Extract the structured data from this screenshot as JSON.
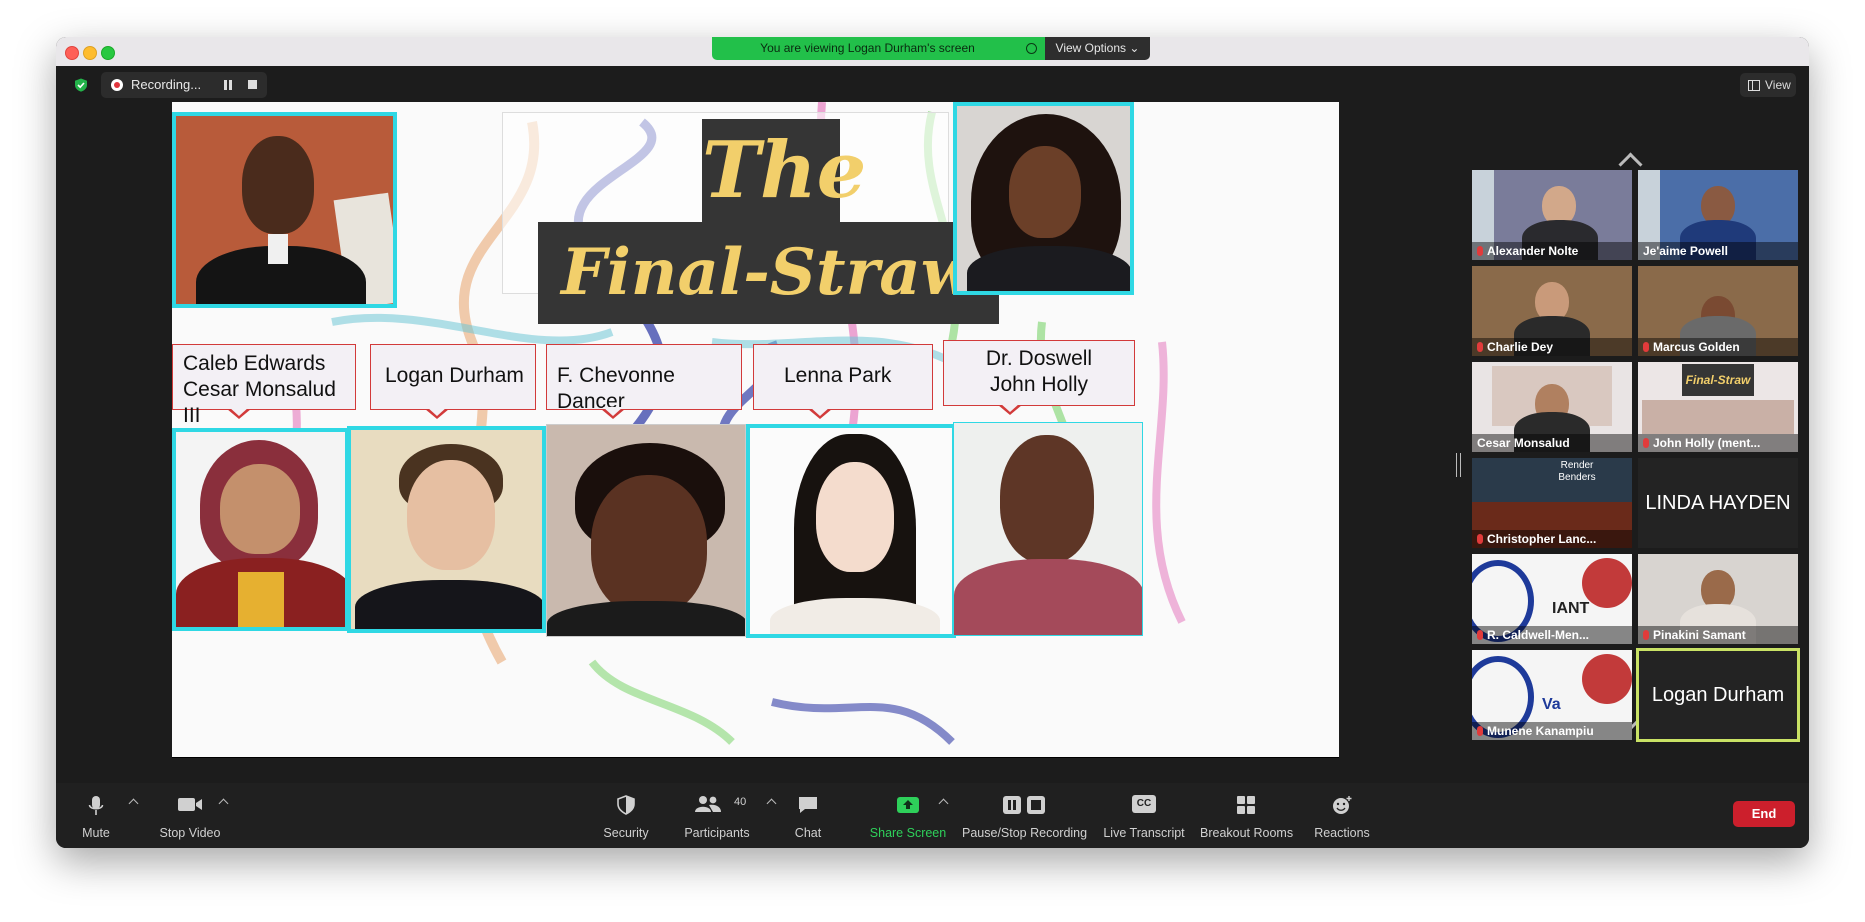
{
  "banner": {
    "text": "You are viewing Logan Durham's screen",
    "view_options": "View Options"
  },
  "top": {
    "recording_label": "Recording...",
    "view_label": "View"
  },
  "slide": {
    "title_line1": "The",
    "title_line2": "Final-Straw",
    "names": [
      {
        "line1": "Caleb Edwards",
        "line2": "Cesar Monsalud III"
      },
      {
        "line1": "Logan Durham",
        "line2": ""
      },
      {
        "line1": "F. Chevonne Dancer",
        "line2": ""
      },
      {
        "line1": "Lenna Park",
        "line2": ""
      },
      {
        "line1": "Dr. Doswell",
        "line2": "John Holly"
      }
    ]
  },
  "gallery": {
    "tiles": [
      {
        "name": "Alexander Nolte",
        "muted": true
      },
      {
        "name": "Je'aime Powell",
        "muted": false
      },
      {
        "name": "Charlie Dey",
        "muted": true
      },
      {
        "name": "Marcus Golden",
        "muted": true
      },
      {
        "name": "Cesar Monsalud",
        "muted": false
      },
      {
        "name": "John Holly (ment...",
        "muted": true
      },
      {
        "name": "Christopher Lanc...",
        "muted": true
      },
      {
        "name": "LINDA HAYDEN",
        "muted": false
      },
      {
        "name": "R. Caldwell-Men...",
        "muted": true
      },
      {
        "name": "Pinakini Samant",
        "muted": true
      },
      {
        "name": "Munene Kanampiu",
        "muted": true
      },
      {
        "name": "Logan Durham",
        "muted": false
      }
    ],
    "render_benders": "Render Benders",
    "variant_text": "IANT",
    "variant_text2": "Va"
  },
  "toolbar": {
    "mute": "Mute",
    "stop_video": "Stop Video",
    "security": "Security",
    "participants": "Participants",
    "participants_count": "40",
    "chat": "Chat",
    "share_screen": "Share Screen",
    "pause_stop": "Pause/Stop Recording",
    "live_transcript": "Live Transcript",
    "cc": "CC",
    "breakout": "Breakout Rooms",
    "reactions": "Reactions",
    "end": "End"
  },
  "colors": {
    "accent_green": "#22c04a",
    "end_red": "#cc1f2c",
    "speaker_highlight": "#c9e265",
    "title_gold": "#f2cf6b"
  }
}
